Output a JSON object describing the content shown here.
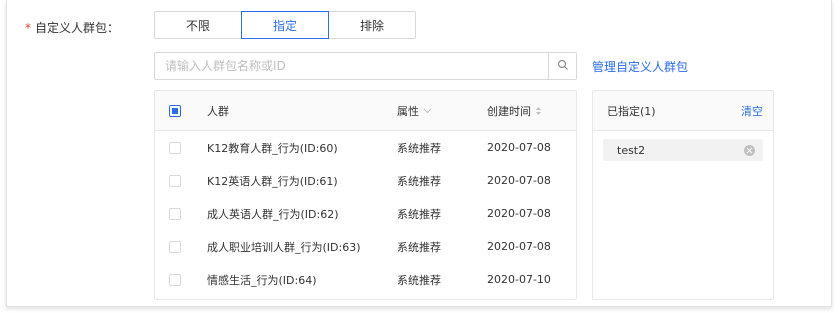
{
  "form": {
    "required_mark": "*",
    "label": "自定义人群包："
  },
  "mode": {
    "options": [
      "不限",
      "指定",
      "排除"
    ],
    "selected": "指定"
  },
  "search": {
    "placeholder": "请输入人群包名称或ID",
    "value": "",
    "icon": "search-icon"
  },
  "manage_link": "管理自定义人群包",
  "table": {
    "header_checkbox": "indeterminate",
    "columns": {
      "name": "人群",
      "attr": "属性",
      "created": "创建时间"
    },
    "rows": [
      {
        "name": "K12教育人群_行为(ID:60)",
        "attr": "系统推荐",
        "created": "2020-07-08",
        "checked": false
      },
      {
        "name": "K12英语人群_行为(ID:61)",
        "attr": "系统推荐",
        "created": "2020-07-08",
        "checked": false
      },
      {
        "name": "成人英语人群_行为(ID:62)",
        "attr": "系统推荐",
        "created": "2020-07-08",
        "checked": false
      },
      {
        "name": "成人职业培训人群_行为(ID:63)",
        "attr": "系统推荐",
        "created": "2020-07-08",
        "checked": false
      },
      {
        "name": "情感生活_行为(ID:64)",
        "attr": "系统推荐",
        "created": "2020-07-10",
        "checked": false
      }
    ]
  },
  "selected_panel": {
    "title": "已指定(1)",
    "clear_label": "清空",
    "items": [
      "test2"
    ]
  },
  "colors": {
    "accent": "#2b6de5",
    "required": "#f04134",
    "border": "#d9d9d9"
  }
}
